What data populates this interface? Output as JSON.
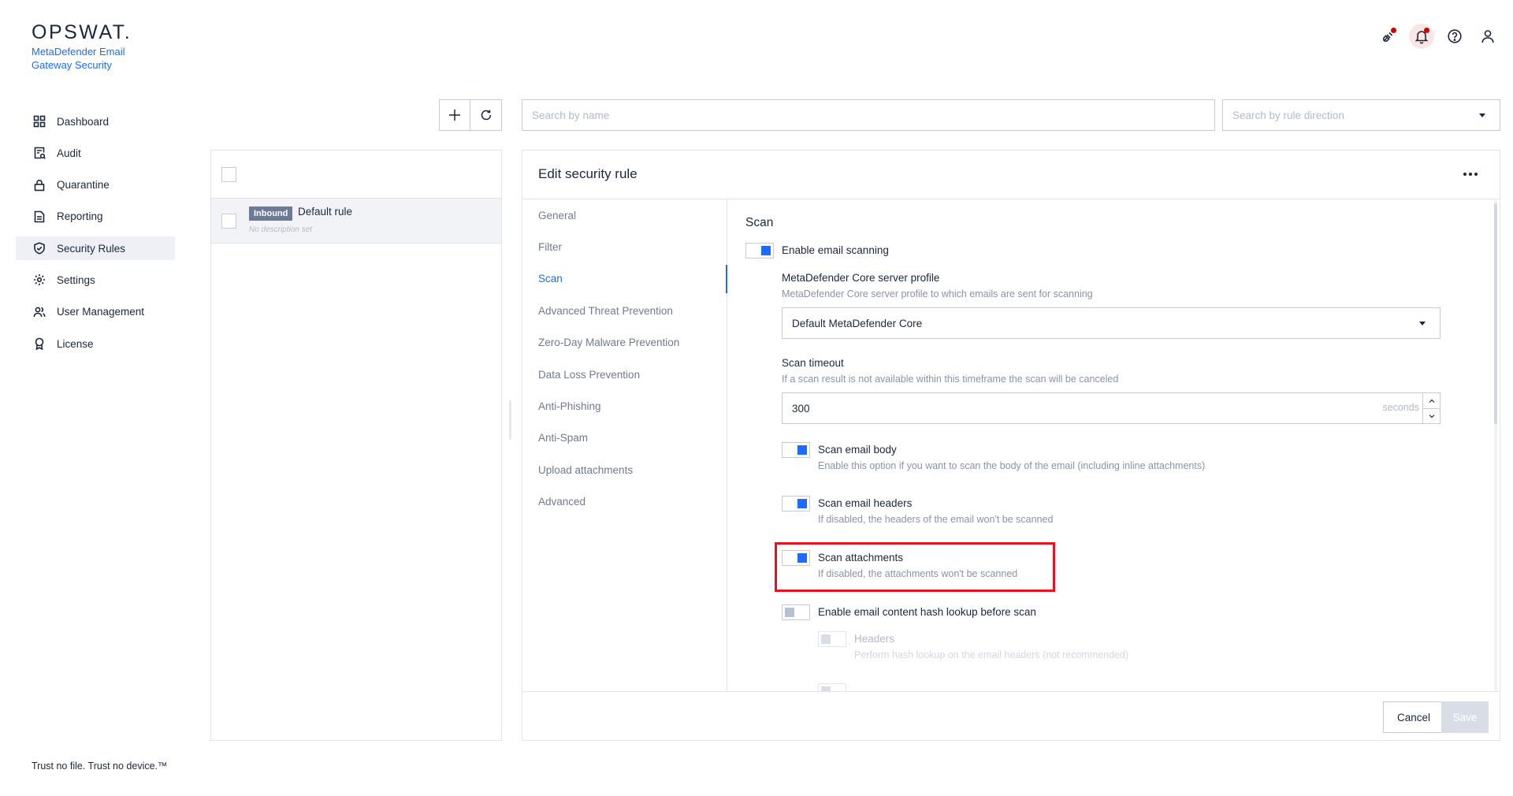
{
  "brand": {
    "logo": "OPSWAT.",
    "product": "MetaDefender Email Gateway Security",
    "tagline": "Trust no file. Trust no device.™"
  },
  "sidebar": {
    "items": [
      {
        "label": "Dashboard",
        "icon": "dashboard-icon"
      },
      {
        "label": "Audit",
        "icon": "audit-icon"
      },
      {
        "label": "Quarantine",
        "icon": "lock-icon"
      },
      {
        "label": "Reporting",
        "icon": "document-icon"
      },
      {
        "label": "Security Rules",
        "icon": "shield-check-icon",
        "active": true
      },
      {
        "label": "Settings",
        "icon": "gear-icon"
      },
      {
        "label": "User Management",
        "icon": "users-icon"
      },
      {
        "label": "License",
        "icon": "badge-icon"
      }
    ]
  },
  "topbar": {
    "icons": [
      "plug-icon",
      "bell-icon",
      "help-icon",
      "user-icon"
    ],
    "alert_color": "#d00300"
  },
  "search": {
    "name_placeholder": "Search by name",
    "direction_placeholder": "Search by rule direction"
  },
  "rules_list": {
    "rows": [
      {
        "direction": "Inbound",
        "name": "Default rule",
        "description": "No description set"
      }
    ]
  },
  "edit": {
    "title": "Edit security rule",
    "tabs": [
      "General",
      "Filter",
      "Scan",
      "Advanced Threat Prevention",
      "Zero-Day Malware Prevention",
      "Data Loss Prevention",
      "Anti-Phishing",
      "Anti-Spam",
      "Upload attachments",
      "Advanced"
    ],
    "active_tab": "Scan",
    "section_title": "Scan",
    "enable_scanning": {
      "label": "Enable email scanning",
      "on": true
    },
    "core_profile": {
      "label": "MetaDefender Core server profile",
      "description": "MetaDefender Core server profile to which emails are sent for scanning",
      "value": "Default MetaDefender Core"
    },
    "scan_timeout": {
      "label": "Scan timeout",
      "description": "If a scan result is not available within this timeframe the scan will be canceled",
      "value": "300",
      "unit": "seconds"
    },
    "scan_body": {
      "label": "Scan email body",
      "description": "Enable this option if you want to scan the body of the email (including inline attachments)",
      "on": true
    },
    "scan_headers": {
      "label": "Scan email headers",
      "description": "If disabled, the headers of the email won't be scanned",
      "on": true
    },
    "scan_attachments": {
      "label": "Scan attachments",
      "description": "If disabled, the attachments won't be scanned",
      "on": true
    },
    "hash_lookup": {
      "label": "Enable email content hash lookup before scan",
      "on": false
    },
    "hash_headers": {
      "label": "Headers",
      "description": "Perform hash lookup on the email headers (not recommended)",
      "on": false
    },
    "cancel_label": "Cancel",
    "save_label": "Save"
  },
  "colors": {
    "accent": "#1d6bfc",
    "highlight": "#e8111d",
    "text": "#1b273c"
  }
}
